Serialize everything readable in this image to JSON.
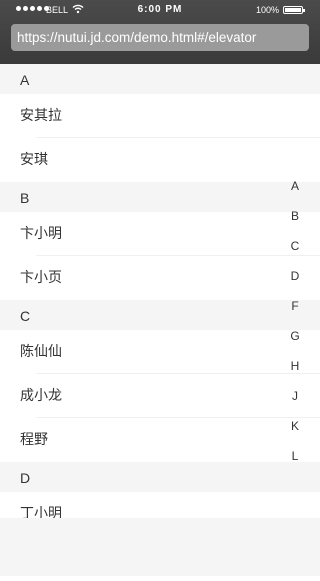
{
  "status_bar": {
    "carrier": "BELL",
    "time": "6:00 PM",
    "battery": "100%"
  },
  "browser": {
    "url": "https://nutui.jd.com/demo.html#/elevator"
  },
  "elevator": {
    "groups": [
      {
        "title": "A",
        "items": [
          "安其拉",
          "安琪"
        ]
      },
      {
        "title": "B",
        "items": [
          "卞小明",
          "卞小页"
        ]
      },
      {
        "title": "C",
        "items": [
          "陈仙仙",
          "成小龙",
          "程野"
        ]
      },
      {
        "title": "D",
        "items": [
          "丁小明"
        ]
      }
    ],
    "index": [
      "A",
      "B",
      "C",
      "D",
      "F",
      "G",
      "H",
      "J",
      "K",
      "L"
    ]
  }
}
